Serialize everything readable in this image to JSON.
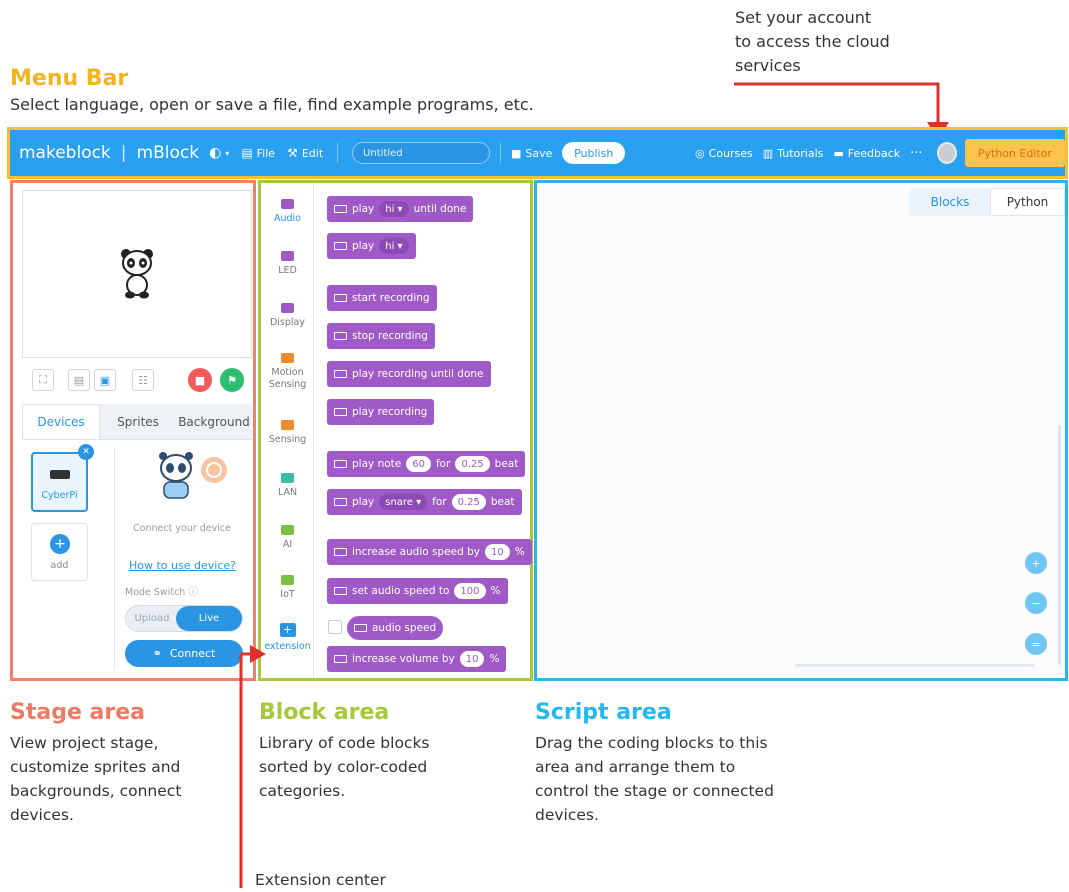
{
  "annotations": {
    "account": {
      "lines": [
        "Set your account",
        "to access the cloud",
        "services"
      ]
    },
    "menu_bar": {
      "title": "Menu Bar",
      "desc": "Select language, open or save a file, find example programs, etc.",
      "color": "#f2b51f"
    },
    "stage_area": {
      "title": "Stage area",
      "lines": [
        "View project stage,",
        "customize sprites and",
        "backgrounds, connect",
        "devices."
      ],
      "color": "#ef7a64"
    },
    "block_area": {
      "title": "Block area",
      "lines": [
        "Library of code blocks",
        "sorted by color-coded",
        "categories."
      ],
      "color": "#a6c93a"
    },
    "script_area": {
      "title": "Script area",
      "lines": [
        "Drag the coding blocks to this",
        "area and arrange them to",
        "control the stage or connected",
        "devices."
      ],
      "color": "#27b7ea"
    },
    "extension_center": {
      "label": "Extension center"
    },
    "arrow_color": "#e0302d"
  },
  "menubar": {
    "brand": "makeblock",
    "product": "mBlock",
    "file": "File",
    "edit": "Edit",
    "project_title": "Untitled",
    "save": "Save",
    "publish": "Publish",
    "courses": "Courses",
    "tutorials": "Tutorials",
    "feedback": "Feedback",
    "more": "···",
    "python_editor": "Python Editor"
  },
  "stage": {
    "tabs": [
      "Devices",
      "Sprites",
      "Background"
    ],
    "device_name": "CyberPi",
    "add_label": "add",
    "connect_hint": "Connect your device",
    "how_to_link": "How to use device?",
    "mode_switch": "Mode Switch",
    "upload": "Upload",
    "live": "Live",
    "connect": "Connect"
  },
  "categories": [
    {
      "label": "Audio",
      "color": "#a05ac7"
    },
    {
      "label": "LED",
      "color": "#a05ac7"
    },
    {
      "label": "Display",
      "color": "#a05ac7"
    },
    {
      "label": "Motion Sensing",
      "color": "#f08a2c"
    },
    {
      "label": "Sensing",
      "color": "#f08a2c"
    },
    {
      "label": "LAN",
      "color": "#3bbfa4"
    },
    {
      "label": "AI",
      "color": "#7cc043"
    },
    {
      "label": "IoT",
      "color": "#7cc043"
    },
    {
      "label": "extension",
      "color": "#2a95e3"
    }
  ],
  "blocks": {
    "play_until_done": {
      "a": "play",
      "dd": "hi",
      "b": "until done"
    },
    "play": {
      "a": "play",
      "dd": "hi"
    },
    "start_recording": "start recording",
    "stop_recording": "stop recording",
    "play_recording_until_done": "play recording until done",
    "play_recording": "play recording",
    "play_note": {
      "a": "play note",
      "v1": "60",
      "b": "for",
      "v2": "0.25",
      "c": "beat"
    },
    "play_drum": {
      "a": "play",
      "dd": "snare",
      "b": "for",
      "v2": "0.25",
      "c": "beat"
    },
    "increase_audio_speed": {
      "a": "increase audio speed by",
      "v": "10",
      "u": "%"
    },
    "set_audio_speed": {
      "a": "set audio speed to",
      "v": "100",
      "u": "%"
    },
    "audio_speed": "audio speed",
    "increase_volume": {
      "a": "increase volume by",
      "v": "10",
      "u": "%"
    }
  },
  "script": {
    "tabs": [
      "Blocks",
      "Python"
    ]
  }
}
